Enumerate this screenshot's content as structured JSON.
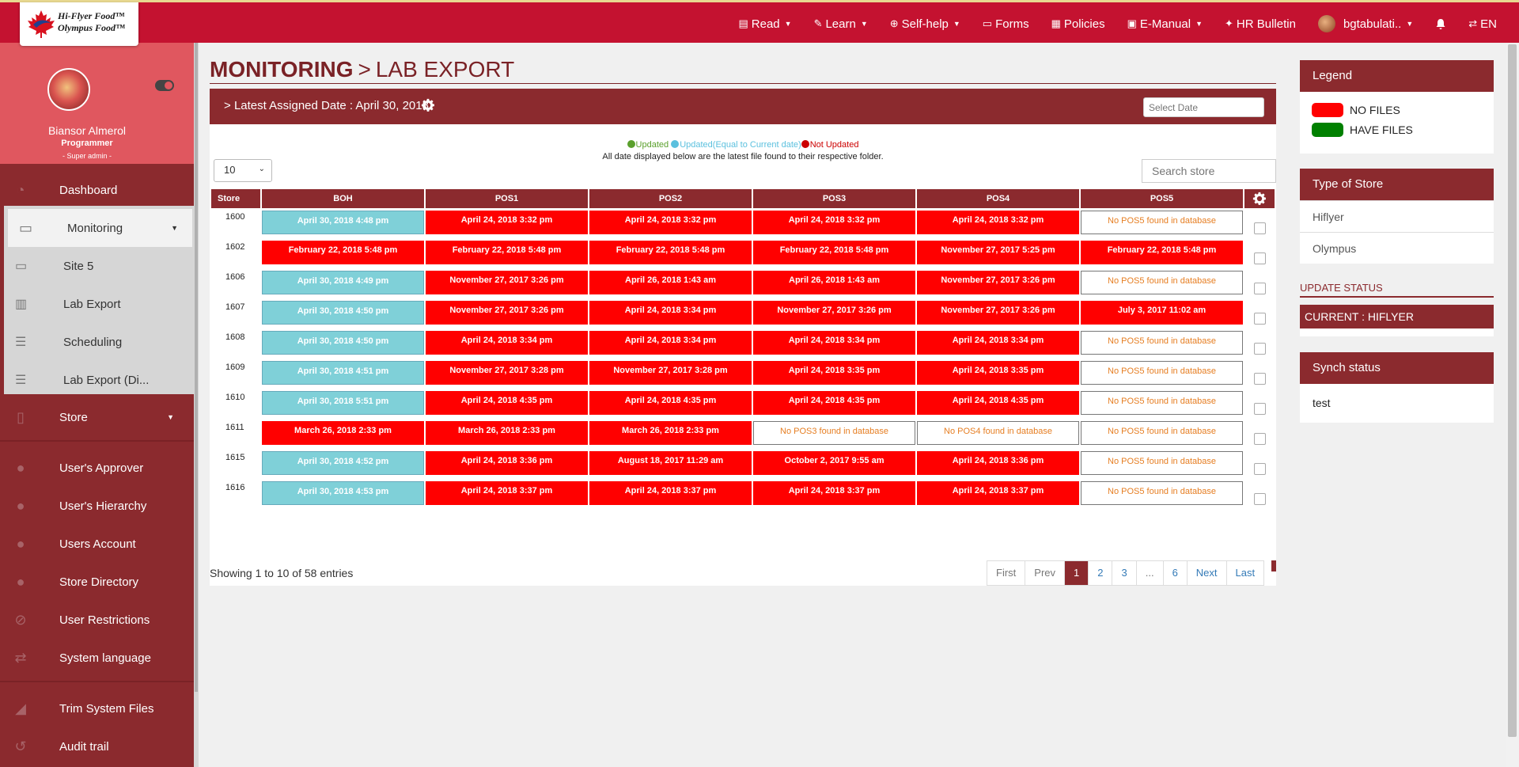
{
  "brand": {
    "line1": "Hi-Flyer Food™",
    "line2": "Olympus Food™"
  },
  "topnav": [
    {
      "icon": "book-icon",
      "label": "Read",
      "caret": true
    },
    {
      "icon": "learn-icon",
      "label": "Learn",
      "caret": true
    },
    {
      "icon": "self-help-icon",
      "label": "Self-help",
      "caret": true
    },
    {
      "icon": "forms-icon",
      "label": "Forms",
      "caret": false
    },
    {
      "icon": "policies-icon",
      "label": "Policies",
      "caret": false
    },
    {
      "icon": "manual-icon",
      "label": "E-Manual",
      "caret": true
    },
    {
      "icon": "pin-icon",
      "label": "HR Bulletin",
      "caret": false
    }
  ],
  "user_menu": {
    "label": "bgtabulati..",
    "language": "EN"
  },
  "profile": {
    "name": "Biansor Almerol",
    "role": "Programmer",
    "level": "- Super admin -"
  },
  "sidebar": {
    "dashboard": "Dashboard",
    "monitoring": "Monitoring",
    "sub": [
      "Site 5",
      "Lab Export",
      "Scheduling",
      "Lab Export (Di..."
    ],
    "store": "Store",
    "items": [
      "User's Approver",
      "User's Hierarchy",
      "Users Account",
      "Store Directory",
      "User Restrictions",
      "System language"
    ],
    "bottom": [
      "Trim System Files",
      "Audit trail"
    ]
  },
  "page": {
    "title_main": "MONITORING",
    "title_sub": "LAB EXPORT"
  },
  "panel": {
    "assigned": "Latest Assigned Date : April 30, 2018",
    "date_placeholder": "Select Date",
    "legend_updated": "Updated",
    "legend_equal": "Updated(Equal to Current date)",
    "legend_not": "Not Updated",
    "info": "All date displayed below are the latest file found to their respective folder.",
    "page_length": "10",
    "search_placeholder": "Search store"
  },
  "table": {
    "headers": [
      "Store",
      "BOH",
      "POS1",
      "POS2",
      "POS3",
      "POS4",
      "POS5"
    ],
    "rows": [
      {
        "store": "1600",
        "cells": [
          [
            "teal",
            "April 30, 2018 4:48 pm"
          ],
          [
            "red",
            "April 24, 2018 3:32 pm"
          ],
          [
            "red",
            "April 24, 2018 3:32 pm"
          ],
          [
            "red",
            "April 24, 2018 3:32 pm"
          ],
          [
            "red",
            "April 24, 2018 3:32 pm"
          ],
          [
            "empty",
            "No POS5 found in database"
          ]
        ]
      },
      {
        "store": "1602",
        "cells": [
          [
            "red",
            "February 22, 2018 5:48 pm"
          ],
          [
            "red",
            "February 22, 2018 5:48 pm"
          ],
          [
            "red",
            "February 22, 2018 5:48 pm"
          ],
          [
            "red",
            "February 22, 2018 5:48 pm"
          ],
          [
            "red",
            "November 27, 2017 5:25 pm"
          ],
          [
            "red",
            "February 22, 2018 5:48 pm"
          ]
        ]
      },
      {
        "store": "1606",
        "cells": [
          [
            "teal",
            "April 30, 2018 4:49 pm"
          ],
          [
            "red",
            "November 27, 2017 3:26 pm"
          ],
          [
            "red",
            "April 26, 2018 1:43 am"
          ],
          [
            "red",
            "April 26, 2018 1:43 am"
          ],
          [
            "red",
            "November 27, 2017 3:26 pm"
          ],
          [
            "empty",
            "No POS5 found in database"
          ]
        ]
      },
      {
        "store": "1607",
        "cells": [
          [
            "teal",
            "April 30, 2018 4:50 pm"
          ],
          [
            "red",
            "November 27, 2017 3:26 pm"
          ],
          [
            "red",
            "April 24, 2018 3:34 pm"
          ],
          [
            "red",
            "November 27, 2017 3:26 pm"
          ],
          [
            "red",
            "November 27, 2017 3:26 pm"
          ],
          [
            "red",
            "July 3, 2017 11:02 am"
          ]
        ]
      },
      {
        "store": "1608",
        "cells": [
          [
            "teal",
            "April 30, 2018 4:50 pm"
          ],
          [
            "red",
            "April 24, 2018 3:34 pm"
          ],
          [
            "red",
            "April 24, 2018 3:34 pm"
          ],
          [
            "red",
            "April 24, 2018 3:34 pm"
          ],
          [
            "red",
            "April 24, 2018 3:34 pm"
          ],
          [
            "empty",
            "No POS5 found in database"
          ]
        ]
      },
      {
        "store": "1609",
        "cells": [
          [
            "teal",
            "April 30, 2018 4:51 pm"
          ],
          [
            "red",
            "November 27, 2017 3:28 pm"
          ],
          [
            "red",
            "November 27, 2017 3:28 pm"
          ],
          [
            "red",
            "April 24, 2018 3:35 pm"
          ],
          [
            "red",
            "April 24, 2018 3:35 pm"
          ],
          [
            "empty",
            "No POS5 found in database"
          ]
        ]
      },
      {
        "store": "1610",
        "cells": [
          [
            "teal",
            "April 30, 2018 5:51 pm"
          ],
          [
            "red",
            "April 24, 2018 4:35 pm"
          ],
          [
            "red",
            "April 24, 2018 4:35 pm"
          ],
          [
            "red",
            "April 24, 2018 4:35 pm"
          ],
          [
            "red",
            "April 24, 2018 4:35 pm"
          ],
          [
            "empty",
            "No POS5 found in database"
          ]
        ]
      },
      {
        "store": "1611",
        "cells": [
          [
            "red",
            "March 26, 2018 2:33 pm"
          ],
          [
            "red",
            "March 26, 2018 2:33 pm"
          ],
          [
            "red",
            "March 26, 2018 2:33 pm"
          ],
          [
            "empty",
            "No POS3 found in database"
          ],
          [
            "empty",
            "No POS4 found in database"
          ],
          [
            "empty",
            "No POS5 found in database"
          ]
        ]
      },
      {
        "store": "1615",
        "cells": [
          [
            "teal",
            "April 30, 2018 4:52 pm"
          ],
          [
            "red",
            "April 24, 2018 3:36 pm"
          ],
          [
            "red",
            "August 18, 2017 11:29 am"
          ],
          [
            "red",
            "October 2, 2017 9:55 am"
          ],
          [
            "red",
            "April 24, 2018 3:36 pm"
          ],
          [
            "empty",
            "No POS5 found in database"
          ]
        ]
      },
      {
        "store": "1616",
        "cells": [
          [
            "teal",
            "April 30, 2018 4:53 pm"
          ],
          [
            "red",
            "April 24, 2018 3:37 pm"
          ],
          [
            "red",
            "April 24, 2018 3:37 pm"
          ],
          [
            "red",
            "April 24, 2018 3:37 pm"
          ],
          [
            "red",
            "April 24, 2018 3:37 pm"
          ],
          [
            "empty",
            "No POS5 found in database"
          ]
        ]
      }
    ]
  },
  "footer": {
    "showing": "Showing 1 to 10 of 58 entries"
  },
  "pagination": [
    "First",
    "Prev",
    "1",
    "2",
    "3",
    "...",
    "6",
    "Next",
    "Last"
  ],
  "pagination_active": "1",
  "legend_panel": {
    "title": "Legend",
    "no_files": "NO FILES",
    "have_files": "HAVE FILES",
    "no_files_color": "#ff0000",
    "have_files_color": "#008000"
  },
  "store_type": {
    "title": "Type of Store",
    "items": [
      "Hiflyer",
      "Olympus"
    ]
  },
  "update_status": {
    "title": "UPDATE STATUS",
    "current": "CURRENT : HIFLYER"
  },
  "synch": {
    "title": "Synch status",
    "value": "test"
  },
  "colors": {
    "brand_red": "#c41230",
    "maroon": "#8b2a2e",
    "teal_updated": "#7fd0d8",
    "not_updated": "#ff0000"
  }
}
